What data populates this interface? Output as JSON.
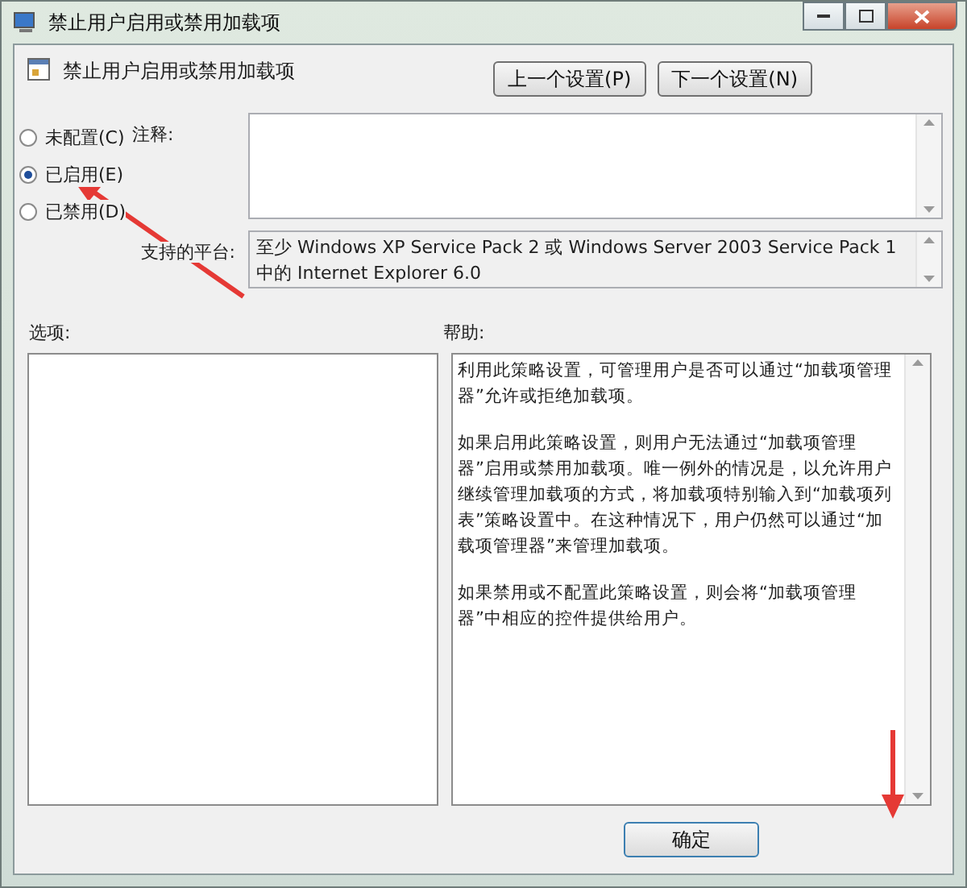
{
  "window": {
    "title": "禁止用户启用或禁用加载项"
  },
  "header": {
    "title": "禁止用户启用或禁用加载项",
    "buttons": [
      "上一个设置(P)",
      "下一个设置(N)"
    ]
  },
  "options": [
    {
      "label": "未配置(C)",
      "selected": false
    },
    {
      "label": "已启用(E)",
      "selected": true
    },
    {
      "label": "已禁用(D)",
      "selected": false
    }
  ],
  "comment": {
    "label": "注释:"
  },
  "platform": {
    "label": "支持的平台:",
    "value": "至少 Windows XP Service Pack 2 或 Windows Server 2003 Service Pack 1中的 Internet Explorer 6.0"
  },
  "options_panel": {
    "label": "选项:"
  },
  "help_panel": {
    "label": "帮助:",
    "paragraphs": [
      "利用此策略设置，可管理用户是否可以通过“加载项管理器”允许或拒绝加载项。",
      "如果启用此策略设置，则用户无法通过“加载项管理器”启用或禁用加载项。唯一例外的情况是，以允许用户继续管理加载项的方式，将加载项特别输入到“加载项列表”策略设置中。在这种情况下，用户仍然可以通过“加载项管理器”来管理加载项。",
      "如果禁用或不配置此策略设置，则会将“加载项管理器”中相应的控件提供给用户。"
    ]
  },
  "footer": {
    "buttons": [
      "确定"
    ]
  }
}
